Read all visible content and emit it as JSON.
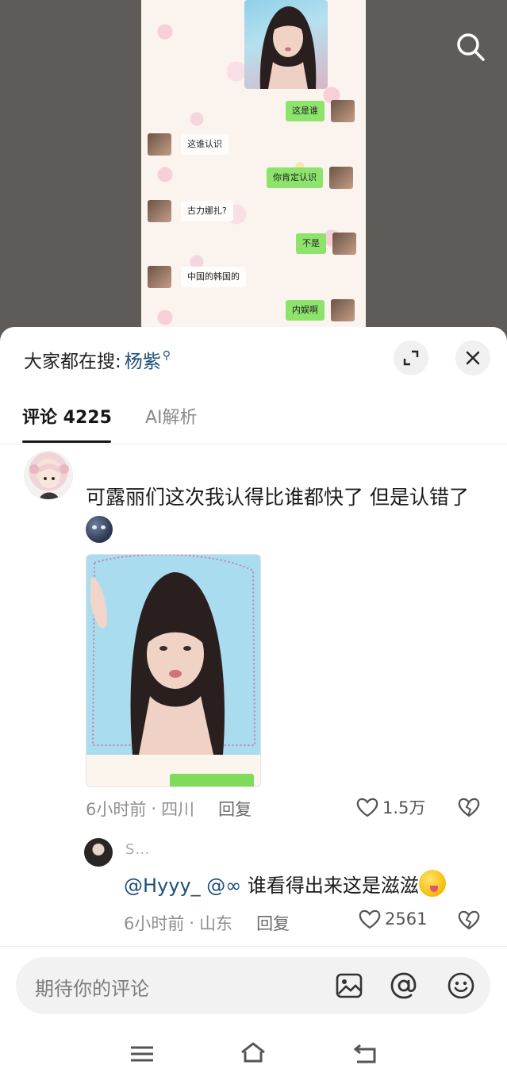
{
  "video": {
    "chat_messages": [
      {
        "side": "right",
        "text": "这是谁"
      },
      {
        "side": "left",
        "text": "这谁认识"
      },
      {
        "side": "right",
        "text": "你肯定认识"
      },
      {
        "side": "left",
        "text": "古力娜扎?"
      },
      {
        "side": "right",
        "text": "不是"
      },
      {
        "side": "left",
        "text": "中国的韩国的"
      },
      {
        "side": "right",
        "text": "内娱啊"
      }
    ]
  },
  "sheet": {
    "trend_prefix": "大家都在搜:",
    "trend_keyword": "杨紫",
    "tabs": [
      {
        "label": "评论 4225",
        "active": true
      },
      {
        "label": "AI解析",
        "active": false
      }
    ]
  },
  "comment": {
    "text": "可露丽们这次我认得比谁都快了 但是认错了",
    "time": "6小时前",
    "location": "四川",
    "reply_label": "回复",
    "likes": "1.5万"
  },
  "reply": {
    "username": "S…",
    "mentions": "@Hyyy_ @∞",
    "text": "谁看得出来这是滋滋",
    "time": "6小时前",
    "location": "山东",
    "reply_label": "回复",
    "likes": "2561"
  },
  "input": {
    "placeholder": "期待你的评论"
  },
  "colors": {
    "accent_link": "#1d4f7a",
    "chat_green": "#8de36b"
  },
  "icons": [
    "search-icon",
    "expand-icon",
    "close-icon",
    "heart-icon",
    "dislike-icon",
    "image-icon",
    "at-icon",
    "emoji-icon",
    "menu-icon",
    "home-icon",
    "back-icon"
  ]
}
